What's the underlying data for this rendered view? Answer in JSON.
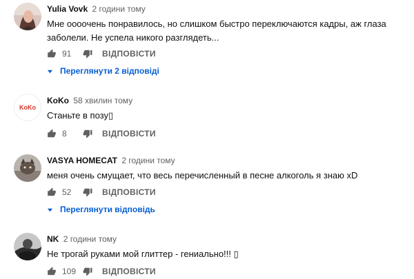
{
  "comments": [
    {
      "author": "Yulia Vovk",
      "time": "2 години тому",
      "text": "Мне оооочень понравилось, но слишком быстро переключаются кадры, аж глаза заболели. Не успела никого разглядеть...",
      "likes": "91",
      "reply_label": "ВІДПОВІСТИ",
      "view_replies": "Переглянути 2 відповіді",
      "avatar_icon": "user-photo-avatar"
    },
    {
      "author": "KoKo",
      "time": "58 хвилин тому",
      "text": "Станьте в позу▯",
      "likes": "8",
      "reply_label": "ВІДПОВІСТИ",
      "avatar_logo_text": "KoKo",
      "avatar_icon": "logo-avatar"
    },
    {
      "author": "VASYA HOMECAT",
      "time": "2 години тому",
      "text": "меня очень смущает, что весь перечисленный в песне алкоголь я знаю xD",
      "likes": "52",
      "reply_label": "ВІДПОВІСТИ",
      "view_replies": "Переглянути відповідь",
      "avatar_icon": "cat-photo-avatar"
    },
    {
      "author": "NK",
      "time": "2 години тому",
      "text": "Не трогай руками мой глиттер - гениально!!! ▯",
      "likes": "109",
      "reply_label": "ВІДПОВІСТИ",
      "avatar_icon": "dark-photo-avatar"
    }
  ],
  "colors": {
    "link": "#065fd4",
    "meta": "#606060",
    "text": "#0f0f0f",
    "koko_red": "#d8332a"
  },
  "icons": [
    "thumbs-up-icon",
    "thumbs-down-icon",
    "caret-down-icon"
  ]
}
